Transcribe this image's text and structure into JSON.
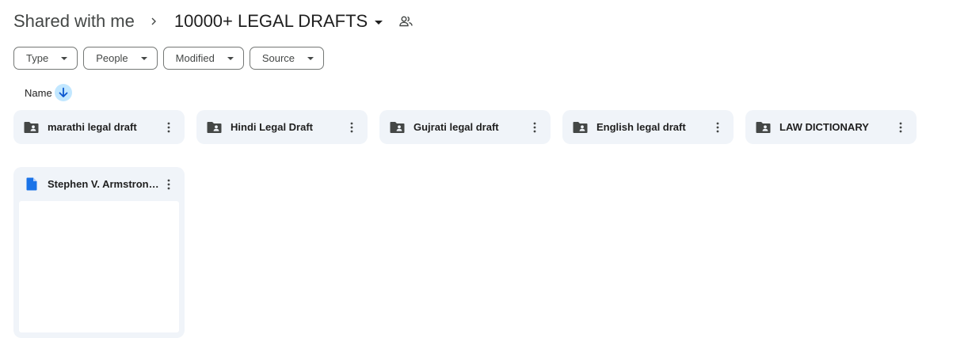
{
  "breadcrumb": {
    "root": "Shared with me",
    "current": "10000+ LEGAL DRAFTS"
  },
  "filters": [
    {
      "label": "Type"
    },
    {
      "label": "People"
    },
    {
      "label": "Modified"
    },
    {
      "label": "Source"
    }
  ],
  "sort": {
    "label": "Name",
    "direction": "descending",
    "icon": "arrow-down-icon"
  },
  "folders": [
    {
      "name": "marathi legal draft",
      "icon": "shared-folder-icon"
    },
    {
      "name": "Hindi Legal Draft",
      "icon": "shared-folder-icon"
    },
    {
      "name": "Gujrati legal draft",
      "icon": "shared-folder-icon"
    },
    {
      "name": "English legal draft",
      "icon": "shared-folder-icon"
    },
    {
      "name": "LAW DICTIONARY",
      "icon": "shared-folder-icon"
    }
  ],
  "files": [
    {
      "name": "Stephen V. Armstrong...",
      "icon": "google-docs-icon"
    }
  ],
  "colors": {
    "card_bg": "#f0f4f9",
    "sort_badge": "#c2e7ff",
    "doc_blue": "#1a73e8",
    "icon_dark": "#444746"
  }
}
